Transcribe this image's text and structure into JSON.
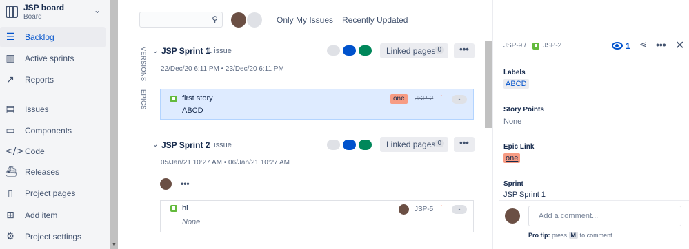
{
  "project": {
    "name": "JSP board",
    "type": "Board"
  },
  "sidebar": {
    "items": [
      {
        "label": "Backlog",
        "icon": "backlog-icon"
      },
      {
        "label": "Active sprints",
        "icon": "board-icon"
      },
      {
        "label": "Reports",
        "icon": "reports-icon"
      },
      {
        "label": "Issues",
        "icon": "issues-icon"
      },
      {
        "label": "Components",
        "icon": "components-icon"
      },
      {
        "label": "Code",
        "icon": "code-icon"
      },
      {
        "label": "Releases",
        "icon": "releases-icon"
      },
      {
        "label": "Project pages",
        "icon": "pages-icon"
      },
      {
        "label": "Add item",
        "icon": "add-item-icon"
      },
      {
        "label": "Project settings",
        "icon": "settings-icon"
      }
    ]
  },
  "toolbar": {
    "search_placeholder": "",
    "quick_filters": [
      "Only My Issues",
      "Recently Updated"
    ]
  },
  "side_tabs": {
    "versions": "VERSIONS",
    "epics": "EPICS"
  },
  "sprints": [
    {
      "name": "JSP Sprint 1",
      "count": "1 issue",
      "dates": "22/Dec/20 6:11 PM • 23/Dec/20 6:11 PM",
      "linked_pages_label": "Linked pages",
      "linked_pages_count": "0",
      "more_label": "•••",
      "issues": [
        {
          "summary": "first story",
          "epic_text": "ABCD",
          "epic_lozenge": "one",
          "key": "JSP-2",
          "priority": "↑",
          "estimate": "-"
        }
      ]
    },
    {
      "name": "JSP Sprint 2",
      "count": "1 issue",
      "dates": "05/Jan/21 10:27 AM • 06/Jan/21 10:27 AM",
      "linked_pages_label": "Linked pages",
      "linked_pages_count": "0",
      "more_label": "•••",
      "assignee_more": "•••",
      "issues": [
        {
          "summary": "hi",
          "epic_text": "None",
          "key": "JSP-5",
          "priority": "↑",
          "estimate": "-"
        }
      ]
    }
  ],
  "colors": {
    "dot_gray": "#dfe1e6",
    "dot_blue": "#0052cc",
    "dot_green": "#00875a",
    "lozenge": "#f79c84",
    "selected": "#deebff"
  },
  "detail": {
    "parent_key": "JSP-9",
    "separator": "/",
    "issue_key": "JSP-2",
    "watch_count": "1",
    "fields": {
      "labels_label": "Labels",
      "labels_value": "ABCD",
      "story_points_label": "Story Points",
      "story_points_value": "None",
      "epic_link_label": "Epic Link",
      "epic_link_value": "one",
      "sprint_label": "Sprint",
      "sprint_value": "JSP Sprint 1"
    },
    "comment_placeholder": "Add a comment...",
    "protip_label": "Pro tip:",
    "protip_pre": "press",
    "protip_key": "M",
    "protip_post": "to comment"
  }
}
